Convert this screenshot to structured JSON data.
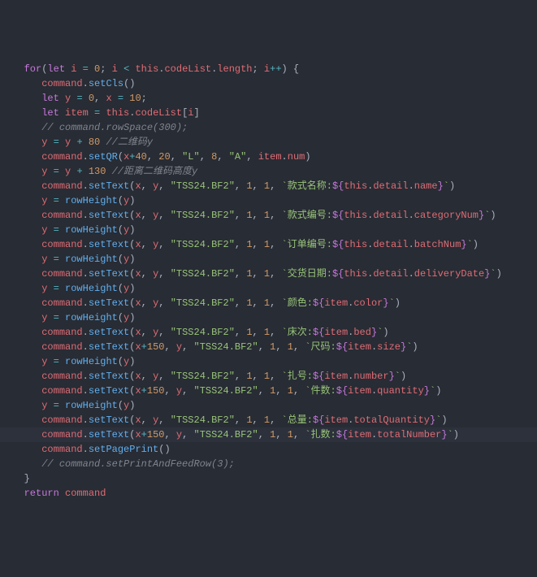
{
  "lines": [
    {
      "indent": 1,
      "type": "for_start"
    },
    {
      "indent": 2,
      "type": "call_noarg",
      "method": "setCls"
    },
    {
      "indent": 2,
      "type": "let_xy"
    },
    {
      "indent": 2,
      "type": "let_item"
    },
    {
      "indent": 2,
      "type": "comment",
      "text": "// command.rowSpace(300);"
    },
    {
      "indent": 2,
      "type": "y_add",
      "value": "80",
      "comment": " //二维码y"
    },
    {
      "indent": 2,
      "type": "setQR"
    },
    {
      "indent": 2,
      "type": "y_add",
      "value": "130",
      "comment": " //距离二维码高度y"
    },
    {
      "indent": 2,
      "type": "setText",
      "x": "x",
      "label": "款式名称:",
      "expr_kind": "thisdetail",
      "expr_prop": "name"
    },
    {
      "indent": 2,
      "type": "rowHeight"
    },
    {
      "indent": 2,
      "type": "setText",
      "x": "x",
      "label": "款式编号:",
      "expr_kind": "thisdetail",
      "expr_prop": "categoryNum"
    },
    {
      "indent": 2,
      "type": "rowHeight"
    },
    {
      "indent": 2,
      "type": "setText",
      "x": "x",
      "label": "订单编号:",
      "expr_kind": "thisdetail",
      "expr_prop": "batchNum"
    },
    {
      "indent": 2,
      "type": "rowHeight"
    },
    {
      "indent": 2,
      "type": "setText",
      "x": "x",
      "label": "交货日期:",
      "expr_kind": "thisdetail",
      "expr_prop": "deliveryDate"
    },
    {
      "indent": 2,
      "type": "rowHeight"
    },
    {
      "indent": 2,
      "type": "setText",
      "x": "x",
      "label": "颜色:",
      "expr_kind": "item",
      "expr_prop": "color"
    },
    {
      "indent": 2,
      "type": "rowHeight"
    },
    {
      "indent": 2,
      "type": "setText",
      "x": "x",
      "label": "床次:",
      "expr_kind": "item",
      "expr_prop": "bed"
    },
    {
      "indent": 2,
      "type": "setText",
      "x": "x+150",
      "label": "尺码:",
      "expr_kind": "item",
      "expr_prop": "size"
    },
    {
      "indent": 2,
      "type": "rowHeight"
    },
    {
      "indent": 2,
      "type": "setText",
      "x": "x",
      "label": "扎号:",
      "expr_kind": "item",
      "expr_prop": "number"
    },
    {
      "indent": 2,
      "type": "setText",
      "x": "x+150",
      "label": "件数:",
      "expr_kind": "item",
      "expr_prop": "quantity"
    },
    {
      "indent": 2,
      "type": "rowHeight"
    },
    {
      "indent": 2,
      "type": "setText",
      "x": "x",
      "label": "总量:",
      "expr_kind": "item",
      "expr_prop": "totalQuantity"
    },
    {
      "indent": 2,
      "type": "setText",
      "x": "x+150",
      "label": "扎数:",
      "expr_kind": "item",
      "expr_prop": "totalNumber",
      "highlight": true,
      "cursor": true
    },
    {
      "indent": 2,
      "type": "call_noarg",
      "method": "setPagePrint"
    },
    {
      "indent": 2,
      "type": "comment",
      "text": "// command.setPrintAndFeedRow(3);"
    },
    {
      "indent": 1,
      "type": "brace_close"
    },
    {
      "indent": 1,
      "type": "return"
    }
  ],
  "strings": {
    "font": "\"TSS24.BF2\"",
    "L": "\"L\"",
    "A": "\"A\""
  },
  "kw": {
    "for": "for",
    "let": "let",
    "this": "this",
    "return": "return"
  },
  "ident": {
    "command": "command",
    "y": "y",
    "x": "x",
    "i": "i",
    "item": "item",
    "rowHeight": "rowHeight",
    "codeList": "codeList",
    "length": "length",
    "detail": "detail",
    "num": "num"
  }
}
